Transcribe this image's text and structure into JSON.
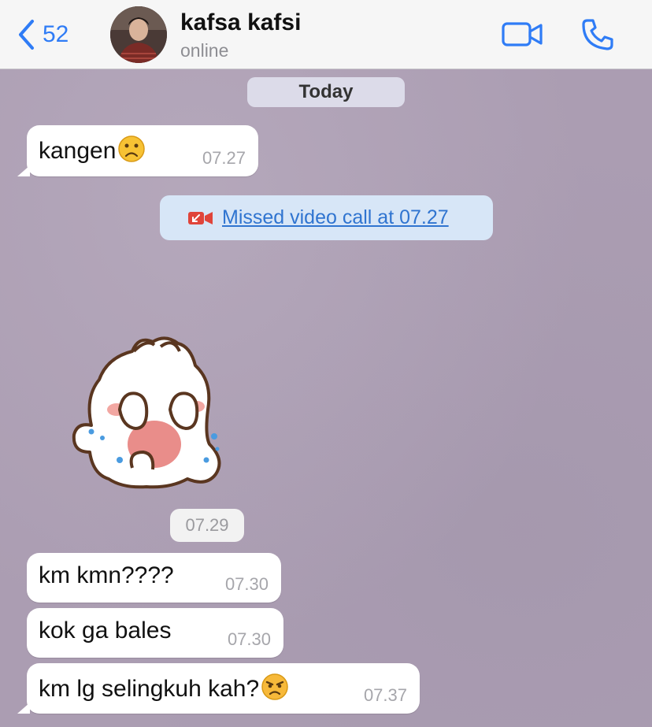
{
  "header": {
    "back_count": "52",
    "contact_name": "kafsa kafsi",
    "contact_status": "online",
    "icons": {
      "back": "chevron-left-icon",
      "video": "video-camera-icon",
      "phone": "phone-icon"
    },
    "accent_color": "#2f7cf6"
  },
  "chat": {
    "date_label": "Today",
    "messages": [
      {
        "text": "kangen",
        "emoji": "frowning-face",
        "time": "07.27"
      },
      {
        "text": "km kmn????",
        "time": "07.30"
      },
      {
        "text": "kok ga bales",
        "time": "07.30"
      },
      {
        "text": "km lg selingkuh kah?",
        "emoji": "angry-face",
        "time": "07.37"
      }
    ],
    "missed_call": {
      "label": "Missed video call at 07.27",
      "icon": "missed-video-call-icon",
      "color": "#e0443a"
    },
    "sticker": {
      "name": "crying-bunny-sticker",
      "time": "07.29"
    }
  }
}
